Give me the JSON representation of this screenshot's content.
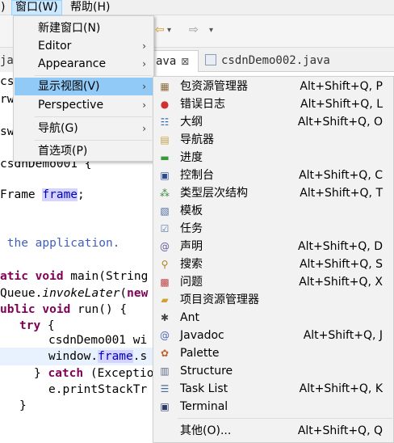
{
  "menubar": {
    "partial_left": ")",
    "window": "窗口(W)",
    "help": "帮助(H)"
  },
  "tabs": {
    "left_partial": "ja",
    "active_partial": "ava",
    "close": "⊠",
    "other": "csdnDemo002.java"
  },
  "code": {
    "l1": "cs",
    "l2": "rwi",
    "l3": "sw",
    "l4": "csdnDemo001 {",
    "l5a": "Frame ",
    "l5b": "frame",
    "l5c": ";",
    "l6": " the application.",
    "l7a": "atic void",
    "l7b": " main(String",
    "l8a": "Queue.",
    "l8b": "invokeLater",
    "l8c": "(",
    "l8d": "new",
    "l9a": "ublic void",
    "l9b": " run() {",
    "l10a": "try",
    "l10b": " {",
    "l11": "csdnDemo001 wi",
    "l12a": "window.",
    "l12b": "frame",
    "l12c": ".s",
    "l13a": "} ",
    "l13b": "catch",
    "l13c": " (Exception",
    "l14": "e.printStackTr",
    "l15": "}"
  },
  "window_menu": {
    "items": [
      {
        "label": "新建窗口(N)",
        "arrow": ""
      },
      {
        "label": "Editor",
        "arrow": "›"
      },
      {
        "label": "Appearance",
        "arrow": "›"
      },
      {
        "label": "显示视图(V)",
        "arrow": "›"
      },
      {
        "label": "Perspective",
        "arrow": "›"
      },
      {
        "label": "导航(G)",
        "arrow": "›"
      },
      {
        "label": "首选项(P)",
        "arrow": ""
      }
    ]
  },
  "show_view_menu": {
    "items": [
      {
        "label": "包资源管理器",
        "shortcut": "Alt+Shift+Q, P",
        "icon": "package-explorer-icon",
        "glyph": "▦",
        "color": "#8b6b3a"
      },
      {
        "label": "错误日志",
        "shortcut": "Alt+Shift+Q, L",
        "icon": "error-log-icon",
        "glyph": "●",
        "color": "#d03030"
      },
      {
        "label": "大纲",
        "shortcut": "Alt+Shift+Q, O",
        "icon": "outline-icon",
        "glyph": "☷",
        "color": "#3a6ab5"
      },
      {
        "label": "导航器",
        "shortcut": "",
        "icon": "navigator-icon",
        "glyph": "▤",
        "color": "#c8a040"
      },
      {
        "label": "进度",
        "shortcut": "",
        "icon": "progress-icon",
        "glyph": "▬",
        "color": "#3a9a3a"
      },
      {
        "label": "控制台",
        "shortcut": "Alt+Shift+Q, C",
        "icon": "console-icon",
        "glyph": "▣",
        "color": "#2a4a9a"
      },
      {
        "label": "类型层次结构",
        "shortcut": "Alt+Shift+Q, T",
        "icon": "type-hierarchy-icon",
        "glyph": "⁂",
        "color": "#3a8a3a"
      },
      {
        "label": "模板",
        "shortcut": "",
        "icon": "templates-icon",
        "glyph": "▧",
        "color": "#4a6aa0"
      },
      {
        "label": "任务",
        "shortcut": "",
        "icon": "tasks-icon",
        "glyph": "☑",
        "color": "#5a7ab0"
      },
      {
        "label": "声明",
        "shortcut": "Alt+Shift+Q, D",
        "icon": "declaration-icon",
        "glyph": "@",
        "color": "#6a5aa0"
      },
      {
        "label": "搜索",
        "shortcut": "Alt+Shift+Q, S",
        "icon": "search-icon",
        "glyph": "⚲",
        "color": "#b08020"
      },
      {
        "label": "问题",
        "shortcut": "Alt+Shift+Q, X",
        "icon": "problems-icon",
        "glyph": "▩",
        "color": "#c04040"
      },
      {
        "label": "项目资源管理器",
        "shortcut": "",
        "icon": "project-explorer-icon",
        "glyph": "▰",
        "color": "#d0a030"
      },
      {
        "label": "Ant",
        "shortcut": "",
        "icon": "ant-icon",
        "glyph": "✱",
        "color": "#444444"
      },
      {
        "label": "Javadoc",
        "shortcut": "Alt+Shift+Q, J",
        "icon": "javadoc-icon",
        "glyph": "@",
        "color": "#4a6ab0"
      },
      {
        "label": "Palette",
        "shortcut": "",
        "icon": "palette-icon",
        "glyph": "✿",
        "color": "#c06030"
      },
      {
        "label": "Structure",
        "shortcut": "",
        "icon": "structure-icon",
        "glyph": "▥",
        "color": "#5a6a8a"
      },
      {
        "label": "Task List",
        "shortcut": "Alt+Shift+Q, K",
        "icon": "task-list-icon",
        "glyph": "☰",
        "color": "#4a6aa0"
      },
      {
        "label": "Terminal",
        "shortcut": "",
        "icon": "terminal-icon",
        "glyph": "▣",
        "color": "#2a3a6a"
      },
      {
        "label": "其他(O)...",
        "shortcut": "Alt+Shift+Q, Q",
        "icon": "",
        "glyph": "",
        "color": "#000000"
      }
    ]
  }
}
